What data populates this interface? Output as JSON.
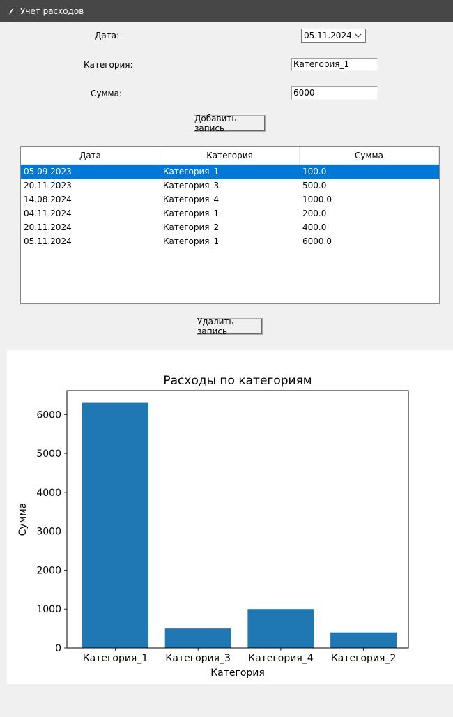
{
  "window": {
    "title": "Учет расходов"
  },
  "form": {
    "date_label": "Дата:",
    "date_value": "05.11.2024",
    "category_label": "Категория:",
    "category_value": "Категория_1",
    "sum_label": "Сумма:",
    "sum_value": "6000",
    "add_button": "Добавить запись"
  },
  "table": {
    "columns": [
      "Дата",
      "Категория",
      "Сумма"
    ],
    "rows": [
      {
        "date": "05.09.2023",
        "category": "Категория_1",
        "sum": "100.0",
        "selected": true
      },
      {
        "date": "20.11.2023",
        "category": "Категория_3",
        "sum": "500.0"
      },
      {
        "date": "14.08.2024",
        "category": "Категория_4",
        "sum": "1000.0"
      },
      {
        "date": "04.11.2024",
        "category": "Категория_1",
        "sum": "200.0"
      },
      {
        "date": "20.11.2024",
        "category": "Категория_2",
        "sum": "400.0"
      },
      {
        "date": "05.11.2024",
        "category": "Категория_1",
        "sum": "6000.0"
      }
    ],
    "selected_color": "#0078d7"
  },
  "delete_button": "Удалить запись",
  "chart_data": {
    "type": "bar",
    "title": "Расходы по категориям",
    "xlabel": "Категория",
    "ylabel": "Сумма",
    "categories": [
      "Категория_1",
      "Категория_3",
      "Категория_4",
      "Категория_2"
    ],
    "values": [
      6300,
      500,
      1000,
      400
    ],
    "ylim": [
      0,
      6615
    ],
    "yticks": [
      0,
      1000,
      2000,
      3000,
      4000,
      5000,
      6000
    ],
    "bar_color": "#1f77b4",
    "grid": false
  }
}
